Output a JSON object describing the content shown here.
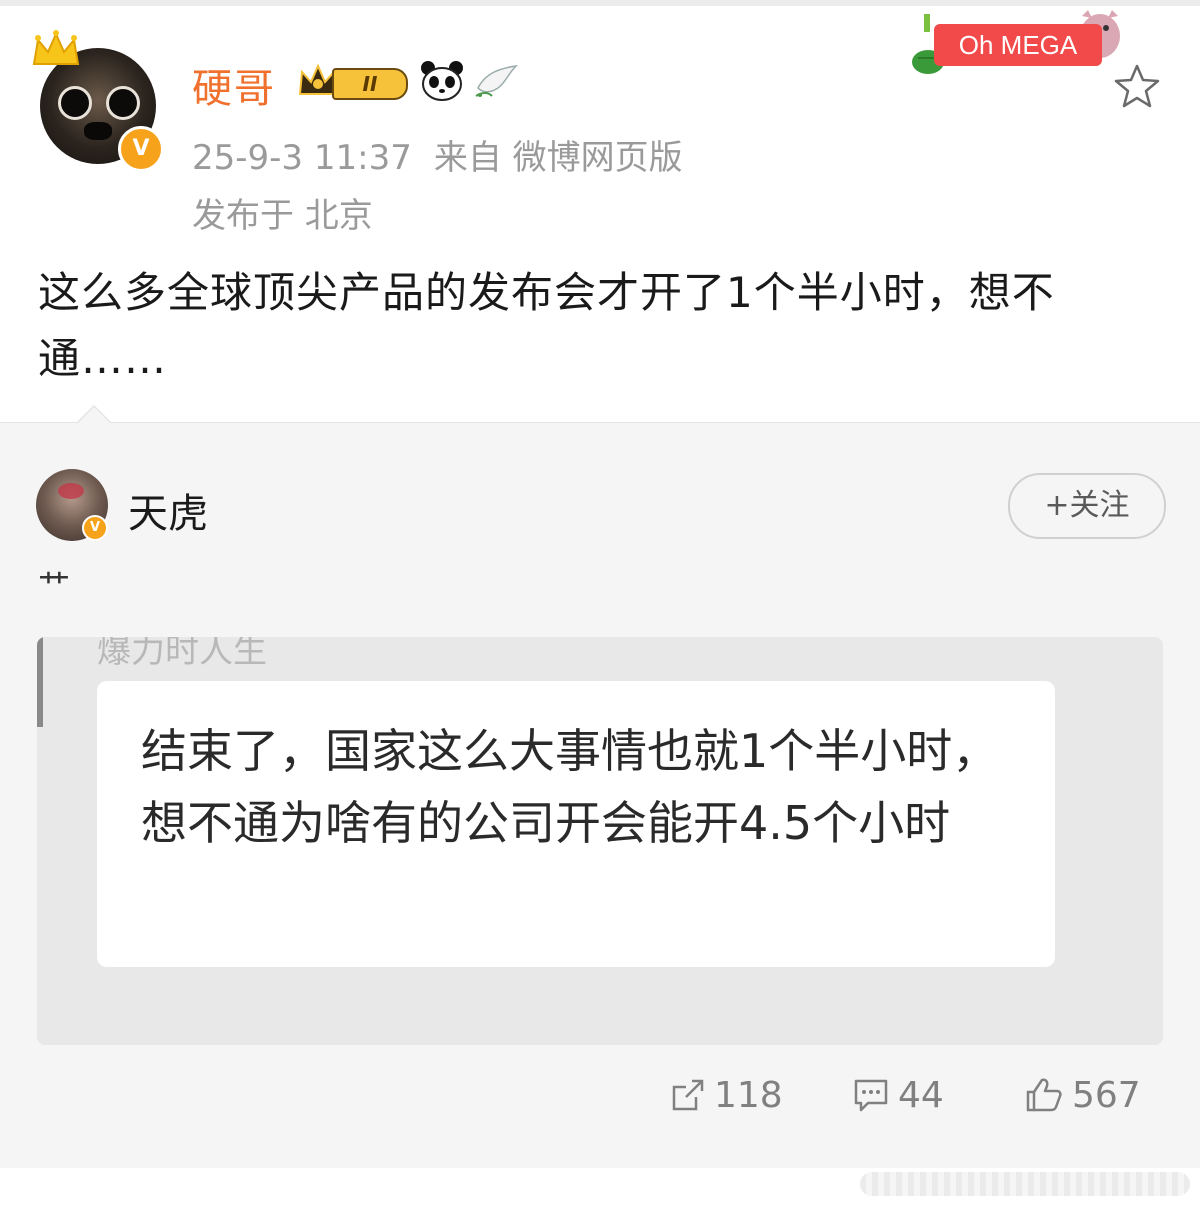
{
  "post": {
    "author": "硬哥",
    "level_badge": "II",
    "timestamp": "25-9-3 11:37",
    "source": "来自 微博网页版",
    "location": "发布于 北京",
    "text": "这么多全球顶尖产品的发布会才开了1个半小时，想不通……",
    "sticker_label": "Oh MEGA"
  },
  "repost": {
    "author": "天虎",
    "follow_label": "+关注",
    "text": "艹",
    "image_text_top": "爆力时人生",
    "image_text": "结束了，国家这么大事情也就1个半小时，想不通为啥有的公司开会能开4.5个小时"
  },
  "actions": {
    "share_count": "118",
    "comment_count": "44",
    "like_count": "567"
  },
  "colors": {
    "author_name": "#f0702e",
    "verified_badge": "#f7a21b",
    "meta_text": "#9a9a9a",
    "repost_bg": "#f5f5f5"
  }
}
